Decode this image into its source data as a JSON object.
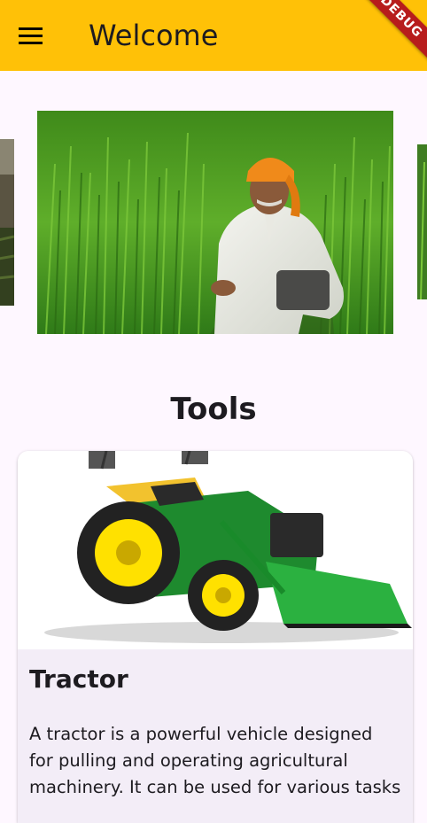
{
  "appbar": {
    "title": "Welcome",
    "menu_icon": "hamburger-menu-icon",
    "debug_banner": "DEBUG",
    "color": "#ffc107"
  },
  "carousel": {
    "slides": [
      "field-landscape-image",
      "farmer-in-wheat-field-image",
      "green-crop-image"
    ]
  },
  "section": {
    "title": "Tools"
  },
  "card": {
    "image": "tractor-image",
    "title": "Tractor",
    "description": "A tractor is a powerful vehicle designed for pulling and operating agricultural machinery. It can be used for various tasks"
  }
}
